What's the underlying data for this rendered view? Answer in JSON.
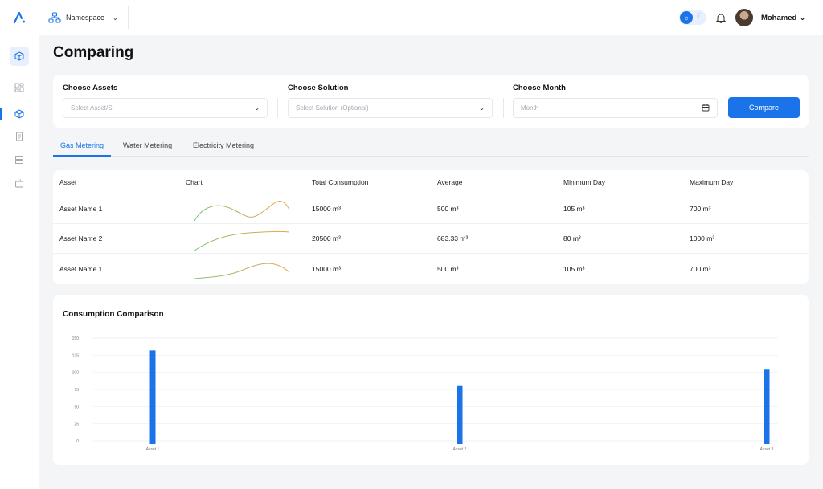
{
  "header": {
    "namespace_label": "Namespace",
    "user_name": "Mohamed"
  },
  "page": {
    "title": "Comparing"
  },
  "filters": {
    "assets": {
      "label": "Choose Assets",
      "placeholder": "Select Asset/S"
    },
    "solution": {
      "label": "Choose Solution",
      "placeholder": "Select Solution (Optional)"
    },
    "month": {
      "label": "Choose Month",
      "placeholder": "Month"
    },
    "compare_label": "Compare"
  },
  "tabs": [
    {
      "label": "Gas Metering",
      "active": true
    },
    {
      "label": "Water Metering",
      "active": false
    },
    {
      "label": "Electricity Metering",
      "active": false
    }
  ],
  "table": {
    "headers": [
      "Asset",
      "Chart",
      "Total Consumption",
      "Average",
      "Minimum Day",
      "Maximum Day"
    ],
    "rows": [
      {
        "asset": "Asset Name 1",
        "total": "15000 m³",
        "average": "500 m³",
        "min": "105 m³",
        "max": "700 m³"
      },
      {
        "asset": "Asset Name 2",
        "total": "20500 m³",
        "average": "683.33 m³",
        "min": "80 m³",
        "max": "1000 m³"
      },
      {
        "asset": "Asset Name 1",
        "total": "15000 m³",
        "average": "500 m³",
        "min": "105 m³",
        "max": "700 m³"
      }
    ]
  },
  "colors": {
    "accent": "#1a73e8",
    "spark_start": "#7cc67a",
    "spark_end": "#f0a04b"
  },
  "chart_data": {
    "type": "bar",
    "title": "Consumption Comparison",
    "categories": [
      "Asset 1",
      "Asset 2",
      "Asset 3"
    ],
    "values": [
      132,
      80,
      104
    ],
    "ylim": [
      0,
      150
    ],
    "yticks": [
      0,
      25,
      50,
      75,
      100,
      125,
      150
    ],
    "grid": true,
    "bar_color": "#1a73e8"
  }
}
